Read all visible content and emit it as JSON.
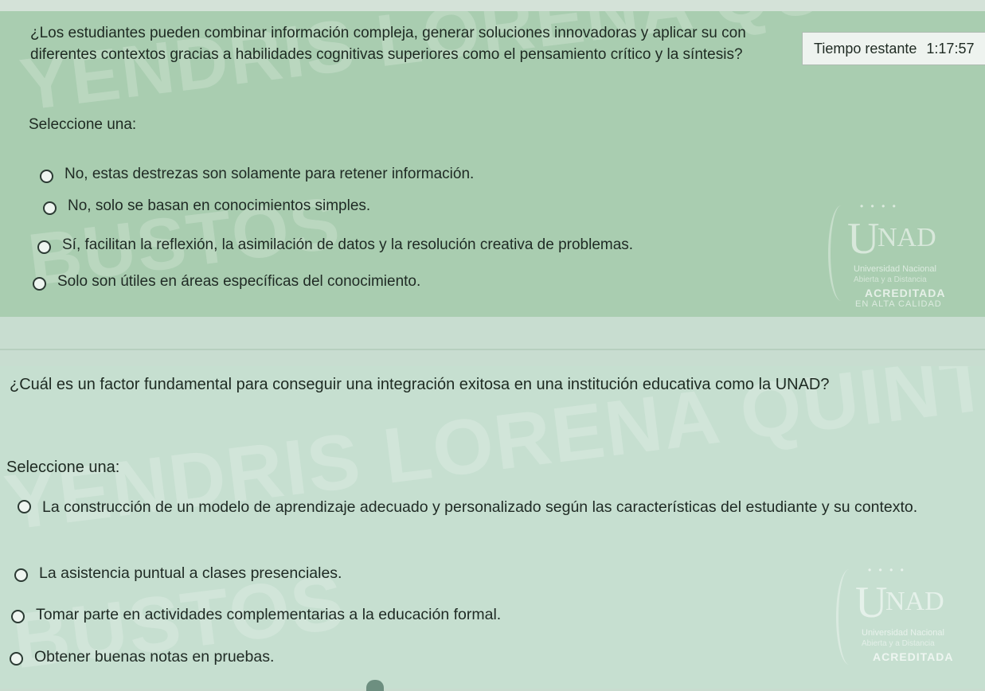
{
  "timer": {
    "label": "Tiempo restante",
    "value": "1:17:57"
  },
  "watermark": {
    "line1": "YENDRIS LORENA QUINTERO",
    "line2": "BUSTOS"
  },
  "logo": {
    "letter_u": "U",
    "letters_nad": "NAD",
    "university": "Universidad Nacional",
    "subtitle": "Abierta y a Distancia",
    "accredited": "ACREDITADA",
    "quality": "EN ALTA CALIDAD"
  },
  "questions": [
    {
      "text": "¿Los estudiantes pueden combinar información compleja, generar soluciones innovadoras y aplicar su con diferentes contextos gracias a habilidades cognitivas superiores como el pensamiento crítico y la síntesis?",
      "select_label": "Seleccione una:",
      "options": [
        "No, estas destrezas son solamente para retener información.",
        "No, solo se basan en conocimientos simples.",
        "Sí, facilitan la reflexión, la asimilación de datos y la resolución creativa de problemas.",
        "Solo son útiles en áreas específicas del conocimiento."
      ]
    },
    {
      "text": "¿Cuál es un factor fundamental para conseguir una integración exitosa en una institución educativa como la UNAD?",
      "select_label": "Seleccione una:",
      "options": [
        "La construcción de un modelo de aprendizaje adecuado y personalizado según las características del estudiante y su contexto.",
        "La asistencia puntual a clases presenciales.",
        "Tomar parte en actividades complementarias a la educación formal.",
        "Obtener buenas notas en pruebas."
      ]
    }
  ],
  "colors": {
    "q1_bg": "#a9cdb0",
    "q2_bg": "#c6dfd0",
    "separator": "#c8ddd0"
  }
}
